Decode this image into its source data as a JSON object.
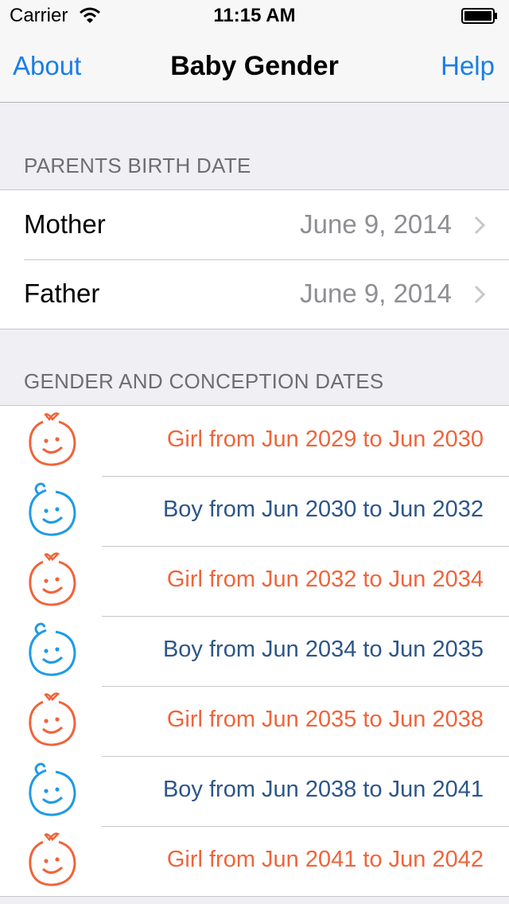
{
  "status_bar": {
    "carrier": "Carrier",
    "time": "11:15 AM"
  },
  "nav": {
    "left_button": "About",
    "title": "Baby Gender",
    "right_button": "Help"
  },
  "parents_section": {
    "header": "PARENTS BIRTH DATE",
    "rows": [
      {
        "label": "Mother",
        "value": "June 9, 2014"
      },
      {
        "label": "Father",
        "value": "June 9, 2014"
      }
    ]
  },
  "results_section": {
    "header": "GENDER AND CONCEPTION DATES",
    "rows": [
      {
        "gender": "girl",
        "icon": "girl-face-icon",
        "text": "Girl from Jun 2029 to Jun 2030"
      },
      {
        "gender": "boy",
        "icon": "boy-face-icon",
        "text": "Boy from Jun 2030 to Jun 2032"
      },
      {
        "gender": "girl",
        "icon": "girl-face-icon",
        "text": "Girl from Jun 2032 to Jun 2034"
      },
      {
        "gender": "boy",
        "icon": "boy-face-icon",
        "text": "Boy from Jun 2034 to Jun 2035"
      },
      {
        "gender": "girl",
        "icon": "girl-face-icon",
        "text": "Girl from Jun 2035 to Jun 2038"
      },
      {
        "gender": "boy",
        "icon": "boy-face-icon",
        "text": "Boy from Jun 2038 to Jun 2041"
      },
      {
        "gender": "girl",
        "icon": "girl-face-icon",
        "text": "Girl from Jun 2041 to Jun 2042"
      }
    ]
  },
  "colors": {
    "accent": "#1a7ee8",
    "girl": "#f0643a",
    "boy": "#2c5689",
    "boy_icon": "#1e9be6"
  }
}
